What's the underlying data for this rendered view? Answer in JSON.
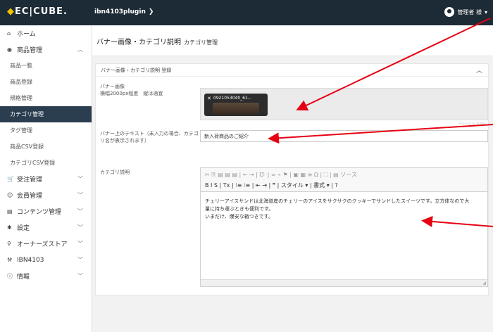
{
  "header": {
    "logo": "EC|CUBE.",
    "plugin": "ibn4103plugin",
    "chevron": "❯",
    "admin": "管理者 様"
  },
  "sidebar": {
    "items": [
      {
        "label": "ホーム",
        "icon": "home-icon"
      },
      {
        "label": "商品管理",
        "icon": "cube-icon",
        "expanded": true
      },
      {
        "label": "受注管理",
        "icon": "cart-icon"
      },
      {
        "label": "会員管理",
        "icon": "users-icon"
      },
      {
        "label": "コンテンツ管理",
        "icon": "file-icon"
      },
      {
        "label": "設定",
        "icon": "gear-icon"
      },
      {
        "label": "オーナーズストア",
        "icon": "plug-icon"
      },
      {
        "label": "IBN4103",
        "icon": "tool-icon"
      },
      {
        "label": "情報",
        "icon": "info-icon"
      }
    ],
    "subitems": [
      "商品一覧",
      "商品登録",
      "規格管理",
      "カテゴリ管理",
      "タグ管理",
      "商品CSV登録",
      "カテゴリCSV登録"
    ],
    "active_subitem": "カテゴリ管理"
  },
  "page": {
    "title": "バナー画像・カテゴリ説明",
    "subtitle": "カテゴリ管理"
  },
  "card": {
    "title": "バナー画像・カテゴリ説明 登録",
    "banner_label_1": "バナー画像",
    "banner_label_2": "横幅2000px程度　縦は適宜",
    "filename": "0921053040_61...",
    "powered": "Powered by PQINA",
    "text_label_1": "バナー上のテキスト（未入力の場合、カテゴ",
    "text_label_2": "リ名が表示されます）",
    "text_value": "新入荷商品のご紹介",
    "desc_label": "カテゴリ説明",
    "toolbar_row1": "✂ ⎘ ▤ ▤ ▤ | ← → | ℧· | ∞ ⌁ ⚑ | ▣ ▦ ≡ Ω | ⛶ | ▤ ソース",
    "toolbar_row2": "B  I  S  | Tx | ⁝≡ ⁝≡ | ⇤ ⇥ | ❞ | スタイル ▾ | 書式 ▾ | ?",
    "desc_line1": "チェリーアイスサンドは北海道産のチェリーのアイスをサクサクのクッキーでサンドしたスイーツです。立方体なので大",
    "desc_line2": "量に持ち運ぶときも便利です。",
    "desc_line3": "いまだけ、爆安な箱つきです。"
  }
}
